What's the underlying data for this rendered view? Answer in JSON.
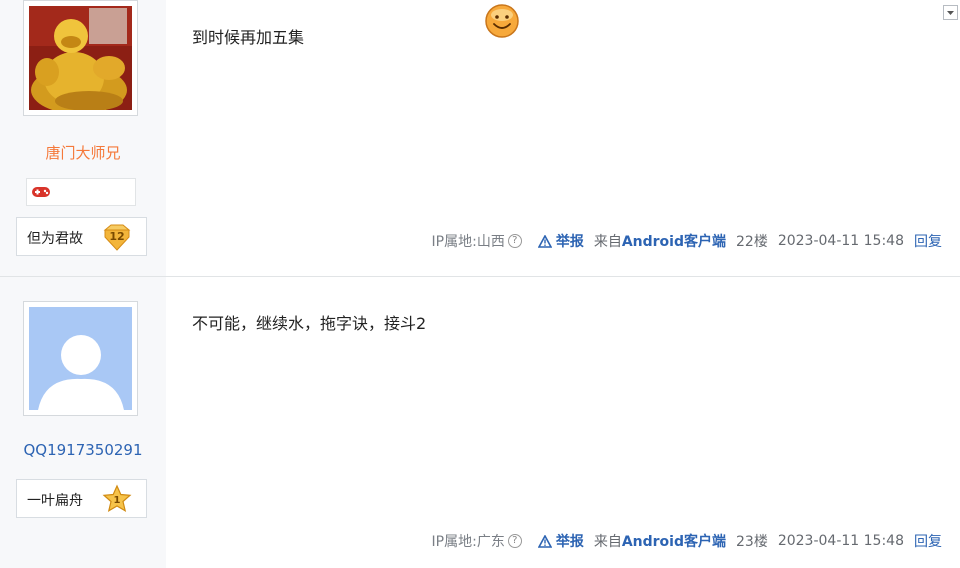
{
  "posts": [
    {
      "username": "唐门大师兄",
      "badge_title": "但为君故",
      "badge_level": "12",
      "content": "到时候再加五集",
      "ip_location": "IP属地:山西",
      "report": "举报",
      "from_prefix": "来自",
      "from_client": "Android客户端",
      "floor": "22楼",
      "time": "2023-04-11 15:48",
      "reply": "回复",
      "colors": {
        "username": "#f5793a"
      },
      "icons": [
        "buddha-avatar",
        "game-controller-icon",
        "smiley-emoji-icon"
      ]
    },
    {
      "username": "QQ1917350291",
      "badge_title": "一叶扁舟",
      "badge_level": "1",
      "content": "不可能，继续水，拖字诀，接斗2",
      "ip_location": "IP属地:广东",
      "report": "举报",
      "from_prefix": "来自",
      "from_client": "Android客户端",
      "floor": "23楼",
      "time": "2023-04-11 15:48",
      "reply": "回复",
      "colors": {
        "username": "#2d64b3"
      },
      "icons": [
        "default-avatar",
        "star-level-icon"
      ]
    }
  ],
  "colors": {
    "link": "#2d64b3",
    "sidebar_bg": "#f7f8fa",
    "divider": "#e1e4e6"
  }
}
